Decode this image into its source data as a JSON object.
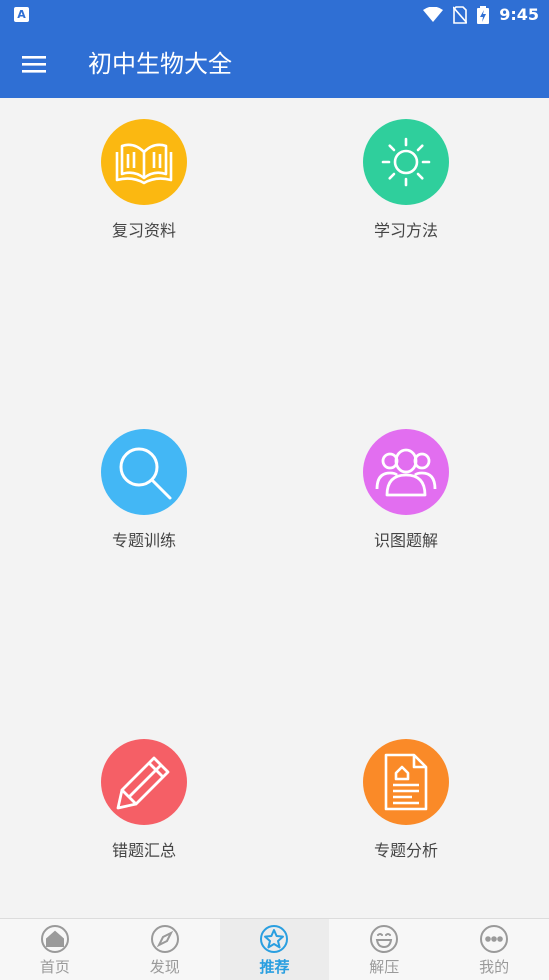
{
  "status_bar": {
    "time": "9:45",
    "left_badge": "A",
    "icons": [
      "wifi-icon",
      "no-sim-icon",
      "battery-charging-icon"
    ]
  },
  "app_bar": {
    "title": "初中生物大全",
    "menu_icon": "hamburger-menu-icon"
  },
  "tiles": [
    {
      "label": "复习资料",
      "icon": "open-book-icon",
      "color": "#fbb811"
    },
    {
      "label": "学习方法",
      "icon": "sun-icon",
      "color": "#2fcf9c"
    },
    {
      "label": "专题训练",
      "icon": "magnifier-icon",
      "color": "#43b7f5"
    },
    {
      "label": "识图题解",
      "icon": "user-group-icon",
      "color": "#e26ef0"
    },
    {
      "label": "错题汇总",
      "icon": "pencil-icon",
      "color": "#f55f66"
    },
    {
      "label": "专题分析",
      "icon": "document-icon",
      "color": "#fa8a28"
    }
  ],
  "tab_bar": {
    "active_color": "#2a9fe0",
    "items": [
      {
        "label": "首页",
        "icon": "home-icon",
        "active": false
      },
      {
        "label": "发现",
        "icon": "compass-icon",
        "active": false
      },
      {
        "label": "推荐",
        "icon": "star-icon",
        "active": true
      },
      {
        "label": "解压",
        "icon": "smile-icon",
        "active": false
      },
      {
        "label": "我的",
        "icon": "more-dots-icon",
        "active": false
      }
    ]
  },
  "colors": {
    "primary": "#2f6fd4",
    "background": "#f3f3f3"
  }
}
